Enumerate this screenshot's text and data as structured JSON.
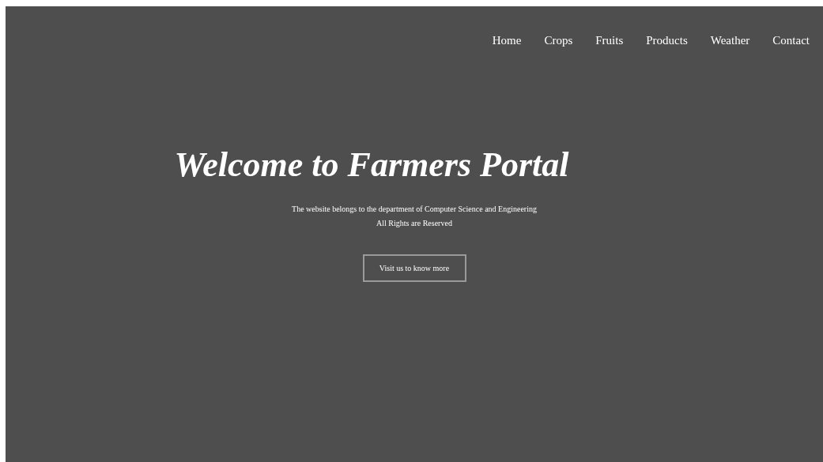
{
  "nav": [
    {
      "label": "Home"
    },
    {
      "label": "Crops"
    },
    {
      "label": "Fruits"
    },
    {
      "label": "Products"
    },
    {
      "label": "Weather"
    },
    {
      "label": "Contact"
    }
  ],
  "hero": {
    "title": "Welcome to Farmers Portal",
    "lines": [
      "The website belongs to the department of Computer Science and Engineering",
      "All Rights are Reserved"
    ],
    "button": "Visit us to know more"
  }
}
